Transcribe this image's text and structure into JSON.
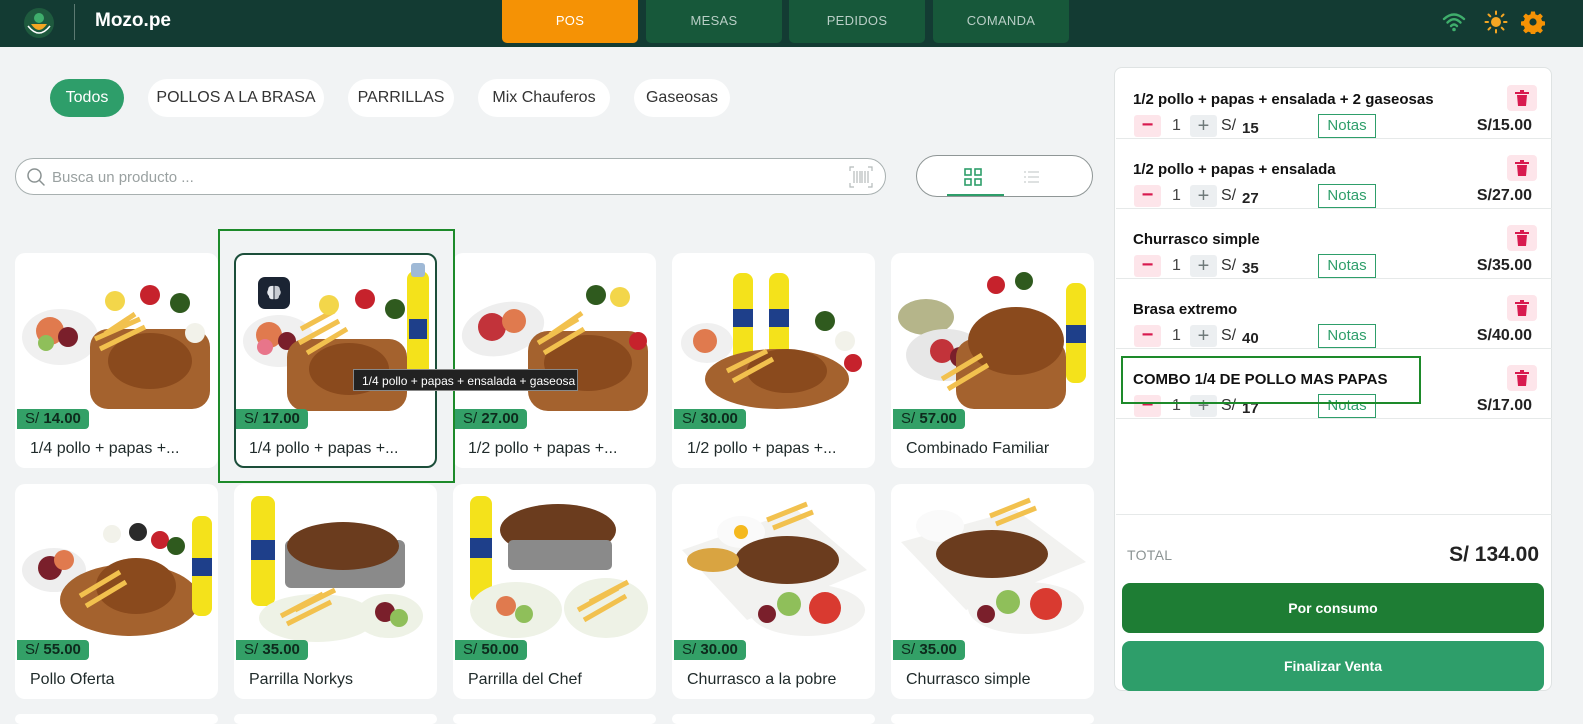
{
  "header": {
    "brand": "Mozo.pe",
    "tabs": [
      {
        "label": "POS",
        "active": true
      },
      {
        "label": "MESAS",
        "active": false
      },
      {
        "label": "PEDIDOS",
        "active": false
      },
      {
        "label": "COMANDA",
        "active": false
      }
    ],
    "icons": [
      "wifi-icon",
      "sun-icon",
      "gear-icon"
    ],
    "colors": {
      "bar": "#133b33",
      "active_tab": "#f59205",
      "tab": "#17583a",
      "accent": "#2e9e6a"
    }
  },
  "categories": [
    {
      "label": "Todos",
      "active": true
    },
    {
      "label": "POLLOS A LA BRASA",
      "active": false
    },
    {
      "label": "PARRILLAS",
      "active": false
    },
    {
      "label": "Mix Chauferos",
      "active": false
    },
    {
      "label": "Gaseosas",
      "active": false
    }
  ],
  "search": {
    "placeholder": "Busca un producto ..."
  },
  "products": [
    {
      "currency": "S/",
      "price": "14.00",
      "name": "1/4 pollo + papas +..."
    },
    {
      "currency": "S/",
      "price": "17.00",
      "name": "1/4 pollo + papas +...",
      "tooltip": "1/4 pollo + papas + ensalada + gaseosa"
    },
    {
      "currency": "S/",
      "price": "27.00",
      "name": "1/2 pollo + papas +..."
    },
    {
      "currency": "S/",
      "price": "30.00",
      "name": "1/2 pollo + papas +..."
    },
    {
      "currency": "S/",
      "price": "57.00",
      "name": "Combinado Familiar"
    },
    {
      "currency": "S/",
      "price": "55.00",
      "name": "Pollo Oferta"
    },
    {
      "currency": "S/",
      "price": "35.00",
      "name": "Parrilla Norkys"
    },
    {
      "currency": "S/",
      "price": "50.00",
      "name": "Parrilla del Chef"
    },
    {
      "currency": "S/",
      "price": "30.00",
      "name": "Churrasco a la pobre"
    },
    {
      "currency": "S/",
      "price": "35.00",
      "name": "Churrasco simple"
    }
  ],
  "order": {
    "items": [
      {
        "name": "1/2 pollo + papas + ensalada + 2 gaseosas",
        "qty": "1",
        "currency": "S/",
        "unit": "15",
        "notes": "Notas",
        "total": "S/15.00"
      },
      {
        "name": "1/2 pollo + papas + ensalada",
        "qty": "1",
        "currency": "S/",
        "unit": "27",
        "notes": "Notas",
        "total": "S/27.00"
      },
      {
        "name": "Churrasco simple",
        "qty": "1",
        "currency": "S/",
        "unit": "35",
        "notes": "Notas",
        "total": "S/35.00"
      },
      {
        "name": "Brasa extremo",
        "qty": "1",
        "currency": "S/",
        "unit": "40",
        "notes": "Notas",
        "total": "S/40.00"
      },
      {
        "name": "COMBO 1/4 DE POLLO MAS PAPAS",
        "qty": "1",
        "currency": "S/",
        "unit": "17",
        "notes": "Notas",
        "total": "S/17.00"
      }
    ],
    "total_label": "TOTAL",
    "total_value": "S/ 134.00",
    "btn_consumo": "Por consumo",
    "btn_finalizar": "Finalizar Venta"
  }
}
